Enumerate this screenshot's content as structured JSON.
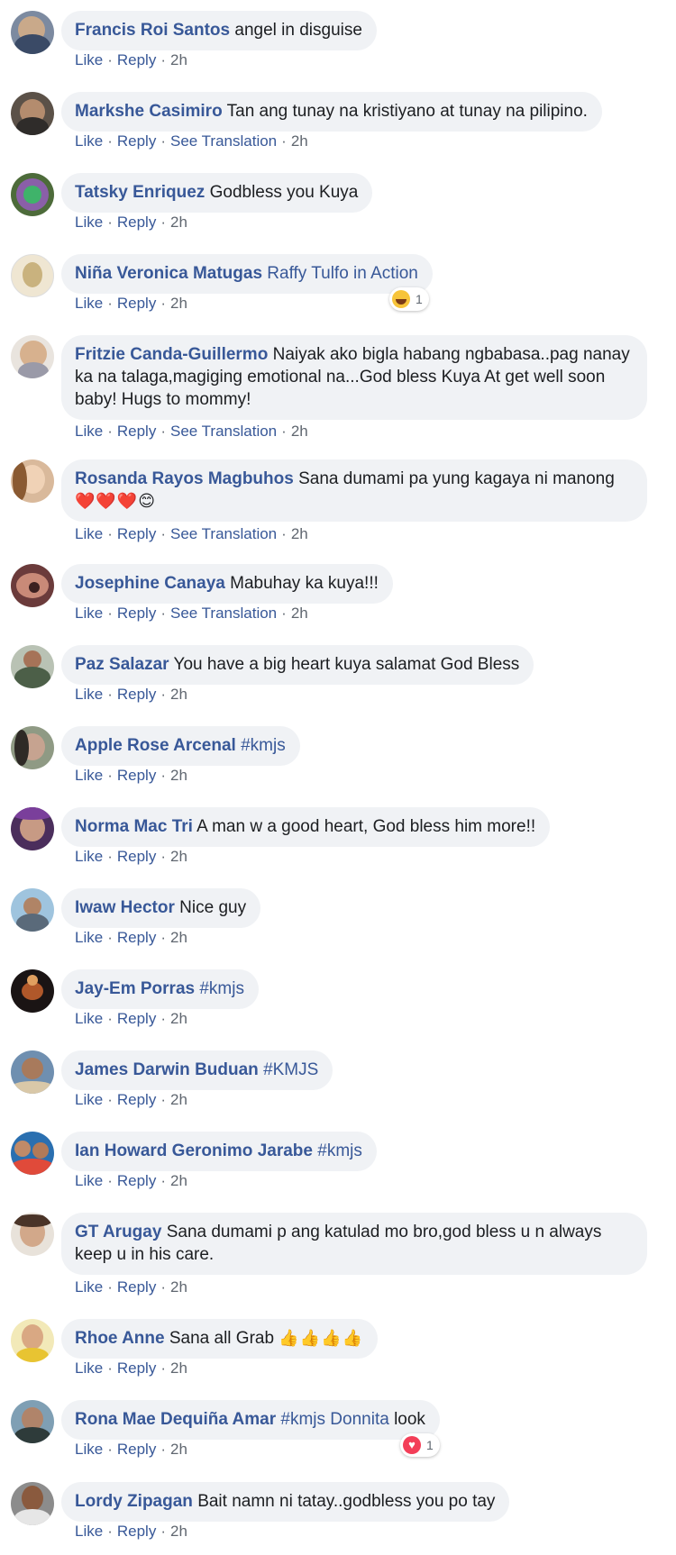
{
  "actions": {
    "like": "Like",
    "reply": "Reply",
    "see_translation": "See Translation",
    "sep": "·"
  },
  "colors": {
    "author": "#385898",
    "bubble": "#f0f2f5",
    "meta": "#606770"
  },
  "comments": [
    {
      "author": "Francis Roi Santos",
      "text": "angel in disguise",
      "time": "2h"
    },
    {
      "author": "Markshe Casimiro",
      "text": "Tan ang tunay na kristiyano at tunay na pilipino.",
      "translation": true,
      "time": "2h"
    },
    {
      "author": "Tatsky Enriquez",
      "text": "Godbless you Kuya",
      "time": "2h"
    },
    {
      "author": "Niña Veronica Matugas",
      "mention": "Raffy Tulfo in Action",
      "time": "2h",
      "reaction": {
        "icon": "haha-icon",
        "count": "1"
      }
    },
    {
      "author": "Fritzie Canda-Guillermo",
      "text": "Naiyak ako bigla habang ngbabasa..pag nanay ka na talaga,magiging emotional na...God bless Kuya At get well soon baby! Hugs to mommy!",
      "translation": true,
      "time": "2h"
    },
    {
      "author": "Rosanda Rayos Magbuhos",
      "text": "Sana dumami pa yung kagaya ni manong",
      "emoji": "❤️❤️❤️😊",
      "translation": true,
      "time": "2h"
    },
    {
      "author": "Josephine Canaya",
      "text": "Mabuhay ka kuya!!!",
      "translation": true,
      "time": "2h"
    },
    {
      "author": "Paz Salazar",
      "text": "You have a big heart kuya salamat God Bless",
      "time": "2h"
    },
    {
      "author": "Apple Rose Arcenal",
      "mention": "#kmjs",
      "time": "2h"
    },
    {
      "author": "Norma Mac Tri",
      "text": "A man w a good heart, God bless him more!!",
      "time": "2h"
    },
    {
      "author": "Iwaw Hector",
      "text": "Nice guy",
      "time": "2h"
    },
    {
      "author": "Jay-Em Porras",
      "mention": "#kmjs",
      "time": "2h"
    },
    {
      "author": "James Darwin Buduan",
      "mention": "#KMJS",
      "time": "2h"
    },
    {
      "author": "Ian Howard Geronimo Jarabe",
      "mention": "#kmjs",
      "time": "2h"
    },
    {
      "author": "GT Arugay",
      "text": "Sana dumami p ang katulad mo bro,god bless u n always keep u in his care.",
      "time": "2h"
    },
    {
      "author": "Rhoe Anne",
      "text": "Sana all Grab",
      "emoji": "👍👍👍👍",
      "time": "2h"
    },
    {
      "author": "Rona Mae Dequiña Amar",
      "mention": "#kmjs Donnita",
      "text": "look",
      "time": "2h",
      "reaction": {
        "icon": "love-icon",
        "count": "1"
      }
    },
    {
      "author": "Lordy Zipagan",
      "text": "Bait namn ni tatay..godbless you po tay",
      "time": "2h"
    }
  ]
}
